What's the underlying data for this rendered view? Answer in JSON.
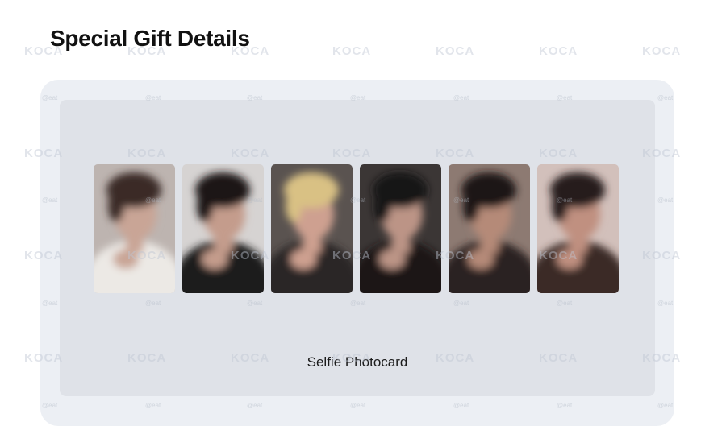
{
  "page": {
    "title": "Special Gift Details"
  },
  "gift": {
    "caption": "Selfie Photocard",
    "photocards": [
      {
        "name": "photocard-1",
        "bg": "#bdb4b0",
        "hair": "#3a2c28",
        "skin": "#c9a596",
        "clothes": "#ece9e5"
      },
      {
        "name": "photocard-2",
        "bg": "#d6d3d2",
        "hair": "#1a1617",
        "skin": "#c49c8c",
        "clothes": "#1e1b1c"
      },
      {
        "name": "photocard-3",
        "bg": "#5a5350",
        "hair": "#d9c184",
        "skin": "#cea090",
        "clothes": "#2a2526"
      },
      {
        "name": "photocard-4",
        "bg": "#3b3635",
        "hair": "#141213",
        "skin": "#bc9486",
        "clothes": "#1b1819"
      },
      {
        "name": "photocard-5",
        "bg": "#8d7a72",
        "hair": "#1e1817",
        "skin": "#b58a78",
        "clothes": "#2b2220"
      },
      {
        "name": "photocard-6",
        "bg": "#d2c0bb",
        "hair": "#281d1c",
        "skin": "#c09080",
        "clothes": "#3a2a27"
      }
    ]
  },
  "watermark": {
    "text": "KOCA",
    "small_text": "@eat"
  }
}
